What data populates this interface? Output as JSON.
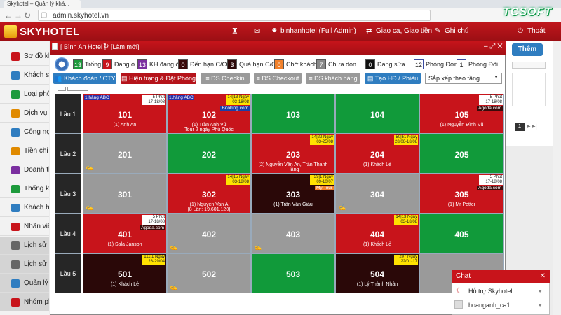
{
  "browser": {
    "tab_title": "Skyhotel – Quản lý khá...",
    "url": "admin.skyhotel.vn",
    "brand_logo": "TCSOFT"
  },
  "header": {
    "logo": "SKYHOTEL",
    "user": "binhanhotel (Full Admin)",
    "shift": "Giao ca, Giao tiền",
    "notes": "Ghi chú",
    "logout": "Thoát"
  },
  "sidebar": {
    "items": [
      {
        "label": "Sơ đồ kh",
        "icon": "map-icon"
      },
      {
        "label": "Khách sạ",
        "icon": "hotel-icon"
      },
      {
        "label": "Loại phò",
        "icon": "room-type-icon"
      },
      {
        "label": "Dịch vụ ă",
        "icon": "service-icon"
      },
      {
        "label": "Công nợ",
        "icon": "debt-icon"
      },
      {
        "label": "Tiền chi",
        "icon": "expense-icon"
      },
      {
        "label": "Doanh th",
        "icon": "revenue-icon"
      },
      {
        "label": "Thống kê",
        "icon": "chart-icon"
      },
      {
        "label": "Khách hà",
        "icon": "customer-icon"
      },
      {
        "label": "Nhân viê",
        "icon": "staff-icon"
      },
      {
        "label": "Lịch sử g",
        "icon": "history-icon"
      },
      {
        "label": "Lịch sử p",
        "icon": "history-doc-icon"
      },
      {
        "label": "Quản lý",
        "icon": "manage-icon"
      },
      {
        "label": "Nhóm ph",
        "icon": "group-icon"
      }
    ]
  },
  "right_panel": {
    "add_button": "Thêm"
  },
  "modal": {
    "hotel": "[ Bình An Hotel ]",
    "refresh": "[Làm mới]",
    "legend": [
      {
        "count": "13",
        "label": "Trống",
        "color": "#1d9a3c"
      },
      {
        "count": "9",
        "label": "Đang ở",
        "color": "#c8141b"
      },
      {
        "count": "13",
        "label": "KH đang ở",
        "color": "#7b2fa0"
      },
      {
        "count": "0",
        "label": "Đến hạn C/O",
        "color": "#3a0a0a"
      },
      {
        "count": "3",
        "label": "Quá hạn C/O",
        "color": "#2a0808"
      },
      {
        "count": "0",
        "label": "Chờ khách",
        "color": "#f0802a"
      },
      {
        "count": "7",
        "label": "Chưa dọn",
        "color": "#888888"
      },
      {
        "count": "0",
        "label": "Đang sửa",
        "color": "#111111"
      },
      {
        "count": "12",
        "label": "Phòng Đơn",
        "color": "#ffffff"
      },
      {
        "count": "1",
        "label": "Phòng Đôi",
        "color": "#ffffff"
      }
    ],
    "buttons": {
      "group_guest": "Khách đoàn / CTY",
      "status_booking": "Hiện trạng & Đặt Phòng",
      "checkin_list": "DS Checkin",
      "checkout_list": "DS Checkout",
      "guest_list": "DS khách hàng",
      "invoice": "Tạo HĐ / Phiếu",
      "sort": "Sắp xếp theo tầng"
    },
    "floors": [
      {
        "label": "Lầu 1",
        "rooms": [
          {
            "num": "101",
            "status": "occupied",
            "tl": "1.hàng ABC",
            "tr1": "5 Phút",
            "tr2": "17-18/08",
            "tr_yel": false,
            "guest": "(1) Anh An",
            "guest2": "",
            "br": "",
            "broom": false
          },
          {
            "num": "102",
            "status": "occupied",
            "tl": "1.hàng ABC",
            "tr1": "14|13 Ngày",
            "tr2": "03-18/08",
            "tr_yel": true,
            "guest": "(1) Trần Anh Vũ",
            "guest2": "Tour 2 ngày Phú Quốc",
            "br": "Booking.com",
            "br_color": "#1a3fa8",
            "broom": false
          },
          {
            "num": "103",
            "status": "empty",
            "tl": "",
            "tr1": "",
            "tr2": "",
            "guest": "",
            "guest2": "",
            "br": "",
            "broom": false
          },
          {
            "num": "104",
            "status": "empty",
            "tl": "",
            "tr1": "",
            "tr2": "",
            "guest": "",
            "guest2": "",
            "br": "",
            "broom": false
          },
          {
            "num": "105",
            "status": "occupied",
            "tl": "",
            "tr1": "5 Phút",
            "tr2": "17-18/08",
            "tr_yel": false,
            "guest": "(1) Nguyễn Đình Vũ",
            "guest2": "",
            "br": "Agoda.com",
            "br_color": "#3a0a0a",
            "broom": false
          }
        ]
      },
      {
        "label": "Lầu 2",
        "rooms": [
          {
            "num": "201",
            "status": "dirty",
            "tl": "",
            "tr1": "",
            "tr2": "",
            "guest": "",
            "guest2": "",
            "br": "",
            "broom": true
          },
          {
            "num": "202",
            "status": "empty",
            "tl": "",
            "tr1": "",
            "tr2": "",
            "guest": "",
            "guest2": "",
            "br": "",
            "broom": false
          },
          {
            "num": "203",
            "status": "occupied",
            "tl": "",
            "tr1": "14|22 Ngày",
            "tr2": "03-25/08",
            "tr_yel": true,
            "guest": "(2) Nguyễn Văn An, Trần Thanh",
            "guest2": "Hằng",
            "br": "",
            "broom": false
          },
          {
            "num": "204",
            "status": "occupied",
            "tl": "",
            "tr1": "50|51 Ngày",
            "tr2": "28/06-18/08",
            "tr_yel": true,
            "guest": "(1) Khách Lẻ",
            "guest2": "",
            "br": "",
            "broom": false
          },
          {
            "num": "205",
            "status": "empty",
            "tl": "",
            "tr1": "",
            "tr2": "",
            "guest": "",
            "guest2": "",
            "br": "",
            "broom": false
          }
        ]
      },
      {
        "label": "Lầu 3",
        "rooms": [
          {
            "num": "301",
            "status": "dirty",
            "tl": "",
            "tr1": "",
            "tr2": "",
            "guest": "",
            "guest2": "",
            "br": "",
            "broom": true
          },
          {
            "num": "302",
            "status": "occupied",
            "tl": "",
            "tr1": "14|15 Ngày",
            "tr2": "03-18/08",
            "tr_yel": true,
            "guest": "(1) Nguyen Van A",
            "guest2": "[8 Lần: 19,601,120]",
            "br": "",
            "broom": false
          },
          {
            "num": "303",
            "status": "overdue",
            "tl": "",
            "tr1": "39|1 Ngày",
            "tr2": "09-10/07",
            "tr_yel": true,
            "guest": "(1) Trần Văn Giàu",
            "guest2": "",
            "br": "My Tour",
            "br_color": "#f0802a",
            "broom": false
          },
          {
            "num": "304",
            "status": "dirty",
            "tl": "",
            "tr1": "",
            "tr2": "",
            "guest": "",
            "guest2": "",
            "br": "",
            "broom": true
          },
          {
            "num": "305",
            "status": "occupied",
            "tl": "",
            "tr1": "5 Phút",
            "tr2": "17-18/08",
            "tr_yel": false,
            "guest": "(1) Mr Petter",
            "guest2": "",
            "br": "Agoda.com",
            "br_color": "#3a0a0a",
            "broom": false
          }
        ]
      },
      {
        "label": "Lầu 4",
        "rooms": [
          {
            "num": "401",
            "status": "occupied",
            "tl": "",
            "tr1": "5 Phút",
            "tr2": "17-18/08",
            "tr_yel": false,
            "guest": "(1) Sala Janson",
            "guest2": "",
            "br": "Agoda.com",
            "br_color": "#3a0a0a",
            "broom": false
          },
          {
            "num": "402",
            "status": "dirty",
            "tl": "",
            "tr1": "",
            "tr2": "",
            "guest": "",
            "guest2": "",
            "br": "",
            "broom": true
          },
          {
            "num": "403",
            "status": "dirty",
            "tl": "",
            "tr1": "",
            "tr2": "",
            "guest": "",
            "guest2": "",
            "br": "",
            "broom": true
          },
          {
            "num": "404",
            "status": "occupied",
            "tl": "",
            "tr1": "14|13 Ngày",
            "tr2": "03-18/08",
            "tr_yel": true,
            "guest": "(1) Khách Lẻ",
            "guest2": "",
            "br": "",
            "broom": false
          },
          {
            "num": "405",
            "status": "empty",
            "tl": "",
            "tr1": "",
            "tr2": "",
            "guest": "",
            "guest2": "",
            "br": "",
            "broom": false
          }
        ]
      },
      {
        "label": "Lầu 5",
        "rooms": [
          {
            "num": "501",
            "status": "overdue",
            "tl": "",
            "tr1": "111|1 Ngày",
            "tr2": "28-29/04",
            "tr_yel": true,
            "guest": "(1) Khách Lẻ",
            "guest2": "",
            "br": "",
            "broom": false
          },
          {
            "num": "502",
            "status": "dirty",
            "tl": "",
            "tr1": "",
            "tr2": "",
            "guest": "",
            "guest2": "",
            "br": "",
            "broom": true
          },
          {
            "num": "503",
            "status": "empty",
            "tl": "",
            "tr1": "",
            "tr2": "",
            "guest": "",
            "guest2": "",
            "br": "",
            "broom": false
          },
          {
            "num": "504",
            "status": "overdue",
            "tl": "",
            "tr1": "207 Ngày",
            "tr2": "22/01-17",
            "tr_yel": true,
            "guest": "(1) Lý Thành Nhân",
            "guest2": "",
            "br": "",
            "broom": false
          },
          {
            "num": "",
            "status": "dirty",
            "tl": "",
            "tr1": "",
            "tr2": "",
            "guest": "",
            "guest2": "",
            "br": "",
            "broom": false
          }
        ]
      }
    ]
  },
  "colors": {
    "empty": "#119a3a",
    "occupied": "#c8141b",
    "dirty": "#9a9a9a",
    "overdue": "#2a0808"
  },
  "chat": {
    "title": "Chat",
    "support": "Hỗ trợ Skyhotel",
    "user": "hoanganh_ca1"
  }
}
